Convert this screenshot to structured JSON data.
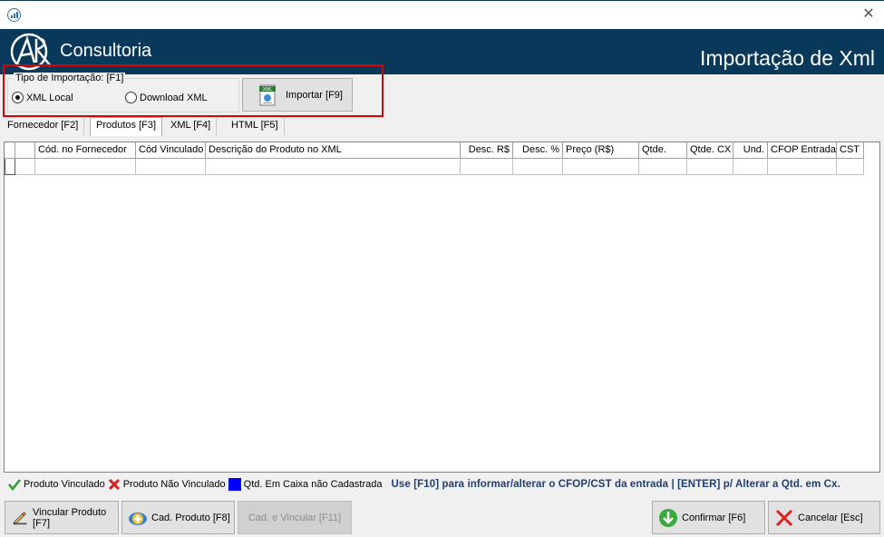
{
  "window": {
    "close_glyph": "✕"
  },
  "header": {
    "brand": "Consultoria",
    "title": "Importação de Xml",
    "background": "#09395a"
  },
  "import_type": {
    "legend": "Tipo de Importação: [F1]",
    "options": [
      {
        "label": "XML Local",
        "selected": true
      },
      {
        "label": "Download XML",
        "selected": false
      }
    ],
    "import_button": "Importar [F9]",
    "import_icon_label": "XML"
  },
  "tabs": [
    {
      "label": "Fornecedor [F2]",
      "active": false
    },
    {
      "label": "Produtos [F3]",
      "active": true
    },
    {
      "label": "XML [F4]",
      "active": false
    },
    {
      "label": "HTML [F5]",
      "active": false
    }
  ],
  "grid": {
    "columns": [
      "",
      "",
      "Cód. no Fornecedor",
      "Cód Vinculado",
      "Descrição do Produto no XML",
      "Desc. R$",
      "Desc. %",
      "Preço (R$)",
      "Qtde.",
      "Qtde. CX",
      "Und.",
      "CFOP Entrada",
      "CST"
    ]
  },
  "legend": {
    "items": [
      {
        "label": "Produto Vinculado",
        "icon": "check-icon",
        "color": "#2e9a2e"
      },
      {
        "label": "Produto Não Vinculado",
        "icon": "x-icon",
        "color": "#d32020"
      },
      {
        "label": "Qtd. Em Caixa não Cadastrada",
        "icon": "blue-square-icon",
        "color": "#0000ff"
      }
    ],
    "hint": "Use [F10] para informar/alterar o CFOP/CST da entrada | [ENTER] p/ Alterar a Qtd. em Cx."
  },
  "footer": {
    "vincular": "Vincular Produto [F7]",
    "cad_produto": "Cad. Produto [F8]",
    "cad_vincular": "Cad. e Vincular [F11]",
    "confirmar": "Confirmar [F6]",
    "cancelar": "Cancelar [Esc]"
  },
  "highlight_color": "#e00000"
}
